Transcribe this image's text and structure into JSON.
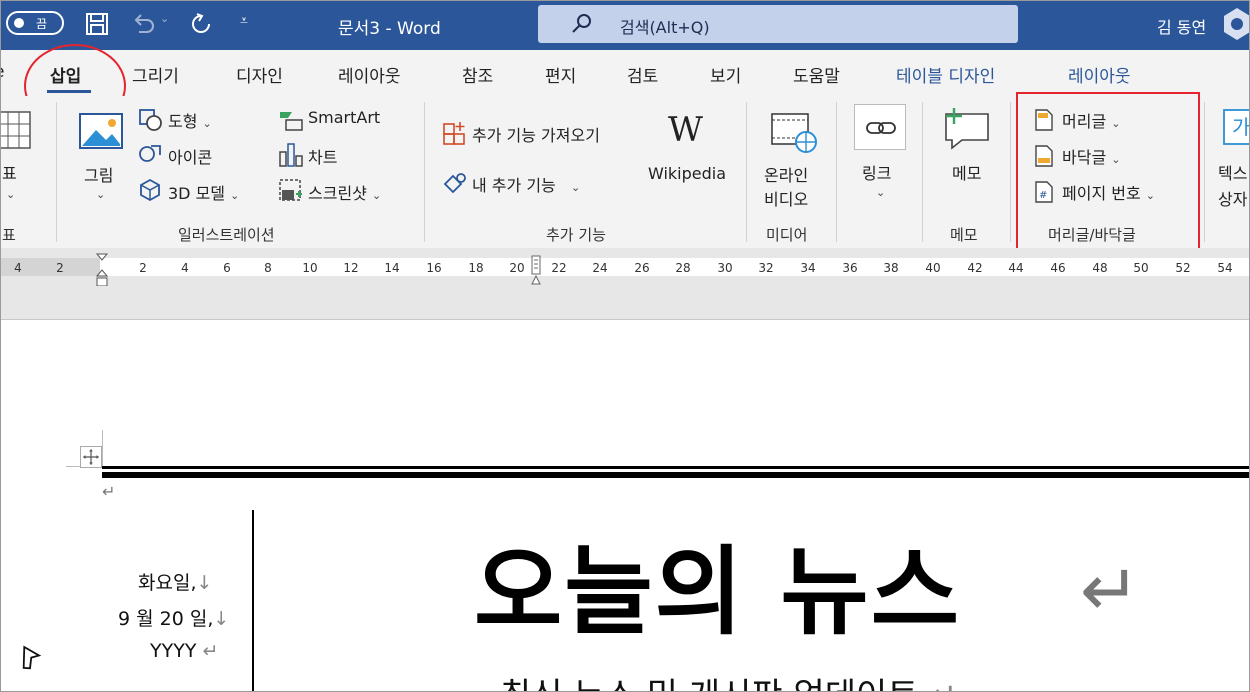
{
  "titlebar": {
    "autosave_label": "끔",
    "doc_title": "문서3  -  Word",
    "search_placeholder": "검색(Alt+Q)",
    "user_name": "김 동연"
  },
  "tabs": [
    {
      "label": "삽입",
      "active": true
    },
    {
      "label": "그리기"
    },
    {
      "label": "디자인"
    },
    {
      "label": "레이아웃"
    },
    {
      "label": "참조"
    },
    {
      "label": "편지"
    },
    {
      "label": "검토"
    },
    {
      "label": "보기"
    },
    {
      "label": "도움말"
    },
    {
      "label": "테이블 디자인",
      "contextual": true
    },
    {
      "label": "레이아웃",
      "contextual": true
    }
  ],
  "ribbon": {
    "table": {
      "top_label": "표",
      "group": "표"
    },
    "illustrations": {
      "picture": "그림",
      "shapes": "도형",
      "icons": "아이콘",
      "models3d": "3D 모델",
      "smartart": "SmartArt",
      "chart": "차트",
      "screenshot": "스크린샷",
      "group": "일러스트레이션"
    },
    "addins": {
      "get_addins": "추가 기능 가져오기",
      "my_addins": "내 추가 기능",
      "wikipedia": "Wikipedia",
      "group": "추가 기능"
    },
    "media": {
      "online_video_1": "온라인",
      "online_video_2": "비디오",
      "group": "미디어"
    },
    "links": {
      "link": "링크"
    },
    "comments": {
      "comment": "메모",
      "group": "메모"
    },
    "header_footer": {
      "header": "머리글",
      "footer": "바닥글",
      "page_number": "페이지 번호",
      "group": "머리글/바닥글"
    },
    "text": {
      "line1": "텍스",
      "line2": "상자"
    }
  },
  "ruler": {
    "ticks": [
      "4",
      "2",
      "2",
      "4",
      "6",
      "8",
      "10",
      "12",
      "14",
      "16",
      "18",
      "20",
      "22",
      "24",
      "26",
      "28",
      "30",
      "32",
      "34",
      "36",
      "38",
      "40",
      "42",
      "44",
      "46",
      "48",
      "50",
      "52",
      "54"
    ]
  },
  "document": {
    "date_line1": "화요일,",
    "date_line2": "9 월 20 일,",
    "date_line3": "YYYY",
    "headline": "오늘의 뉴스",
    "subheadline": "최신 뉴스 및 게시판 업데이트"
  },
  "colors": {
    "word_blue": "#2b579a",
    "annotation_red": "#e4252f"
  }
}
